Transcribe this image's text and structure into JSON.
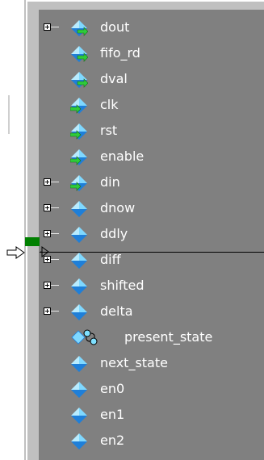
{
  "signals": [
    {
      "label": "dout",
      "expandable": true,
      "icon": "bus-signal-out-icon"
    },
    {
      "label": "fifo_rd",
      "expandable": false,
      "icon": "signal-out-icon"
    },
    {
      "label": "dval",
      "expandable": false,
      "icon": "signal-out-icon"
    },
    {
      "label": "clk",
      "expandable": false,
      "icon": "signal-in-icon"
    },
    {
      "label": "rst",
      "expandable": false,
      "icon": "signal-in-icon"
    },
    {
      "label": "enable",
      "expandable": false,
      "icon": "signal-in-icon"
    },
    {
      "label": "din",
      "expandable": true,
      "icon": "bus-signal-in-icon"
    },
    {
      "label": "dnow",
      "expandable": true,
      "icon": "bus-signal-internal-icon"
    },
    {
      "label": "ddly",
      "expandable": true,
      "icon": "bus-signal-internal-icon"
    },
    {
      "label": "diff",
      "expandable": true,
      "icon": "bus-signal-internal-icon"
    },
    {
      "label": "shifted",
      "expandable": true,
      "icon": "bus-signal-internal-icon"
    },
    {
      "label": "delta",
      "expandable": true,
      "icon": "bus-signal-internal-icon"
    },
    {
      "label": "present_state",
      "expandable": false,
      "icon": "state-machine-icon"
    },
    {
      "label": "next_state",
      "expandable": false,
      "icon": "signal-internal-icon"
    },
    {
      "label": "en0",
      "expandable": false,
      "icon": "signal-internal-icon"
    },
    {
      "label": "en1",
      "expandable": false,
      "icon": "signal-internal-icon"
    },
    {
      "label": "en2",
      "expandable": false,
      "icon": "signal-internal-icon"
    }
  ],
  "colors": {
    "pane_background": "#808080",
    "label_text": "#ffffff",
    "diamond_light": "#7fd8ff",
    "diamond_dark": "#1f7fd8",
    "arrow_green": "#2ecc3a",
    "marker_green": "#008000"
  }
}
